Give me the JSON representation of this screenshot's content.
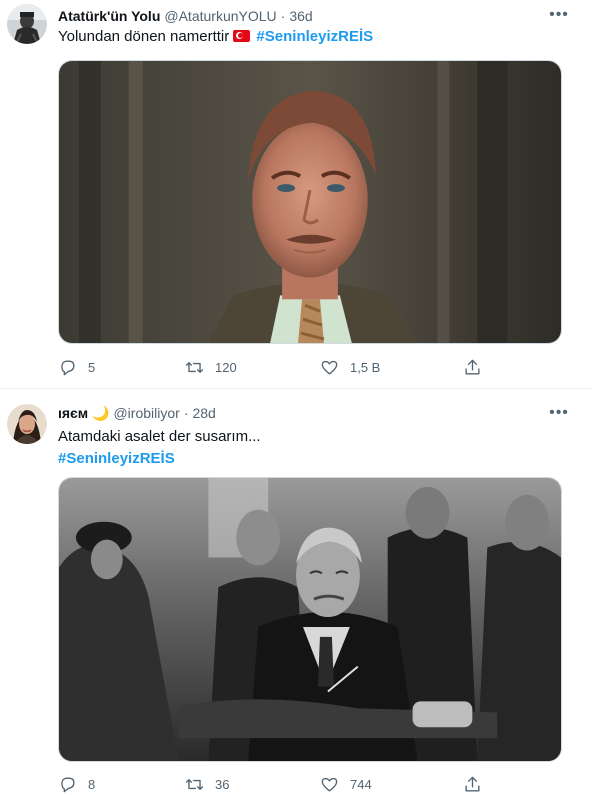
{
  "tweets": [
    {
      "display_name": "Atatürk'ün Yolu",
      "handle": "@AtaturkunYOLU",
      "separator": "·",
      "age": "36d",
      "text_before": "Yolundan dönen namerttir",
      "flag_icon": "turkey-flag-icon",
      "hashtag": "#SeninleyizREİS",
      "text_line": "",
      "replies": "5",
      "retweets": "120",
      "likes": "1,5 B"
    },
    {
      "display_name": "ıяєм 🌙",
      "handle": "@irobiliyor",
      "separator": "·",
      "age": "28d",
      "text_before": "Atamdaki asalet der susarım...",
      "hashtag": "#SeninleyizREİS",
      "replies": "8",
      "retweets": "36",
      "likes": "744"
    }
  ],
  "icons": {
    "more": "more-options-icon",
    "reply": "reply-icon",
    "retweet": "retweet-icon",
    "like": "like-icon",
    "share": "share-icon"
  },
  "colors": {
    "accent": "#1d9bf0",
    "muted": "#536471",
    "text": "#0f1419",
    "divider": "#eff3f4"
  }
}
